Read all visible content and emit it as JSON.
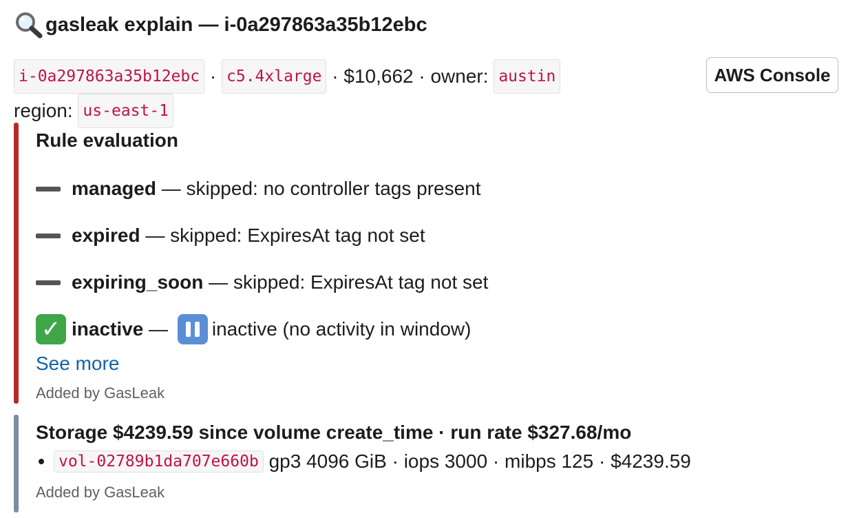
{
  "header": {
    "title": "gasleak explain — i-0a297863a35b12ebc",
    "icon": "magnifying-glass-icon"
  },
  "meta": {
    "instance_id": "i-0a297863a35b12ebc",
    "instance_type": "c5.4xlarge",
    "cost": "$10,662",
    "owner_label": "owner:",
    "owner": "austin",
    "region_label": "region:",
    "region": "us-east-1",
    "separator": " · "
  },
  "actions": {
    "aws_console_label": "AWS Console"
  },
  "rule_evaluation": {
    "title": "Rule evaluation",
    "accent_color": "#b72a2a",
    "rules": [
      {
        "name": "managed",
        "status_icon": "dash-icon",
        "detail": "skipped: no controller tags present"
      },
      {
        "name": "expired",
        "status_icon": "dash-icon",
        "detail": "skipped: ExpiresAt tag not set"
      },
      {
        "name": "expiring_soon",
        "status_icon": "dash-icon",
        "detail": "skipped: ExpiresAt tag not set"
      },
      {
        "name": "inactive",
        "status_icon": "check-icon",
        "detail_icon": "pause-icon",
        "detail": "inactive (no activity in window)"
      }
    ],
    "em_dash": " — ",
    "see_more": "See more",
    "added_by": "Added by GasLeak"
  },
  "storage": {
    "accent_color": "#7d8ba3",
    "title": "Storage $4239.59 since volume create_time · run rate $327.68/mo",
    "volumes": [
      {
        "id": "vol-02789b1da707e660b",
        "details": "gp3 4096 GiB · iops 3000 · mibps 125 · $4239.59"
      }
    ],
    "added_by": "Added by GasLeak"
  }
}
